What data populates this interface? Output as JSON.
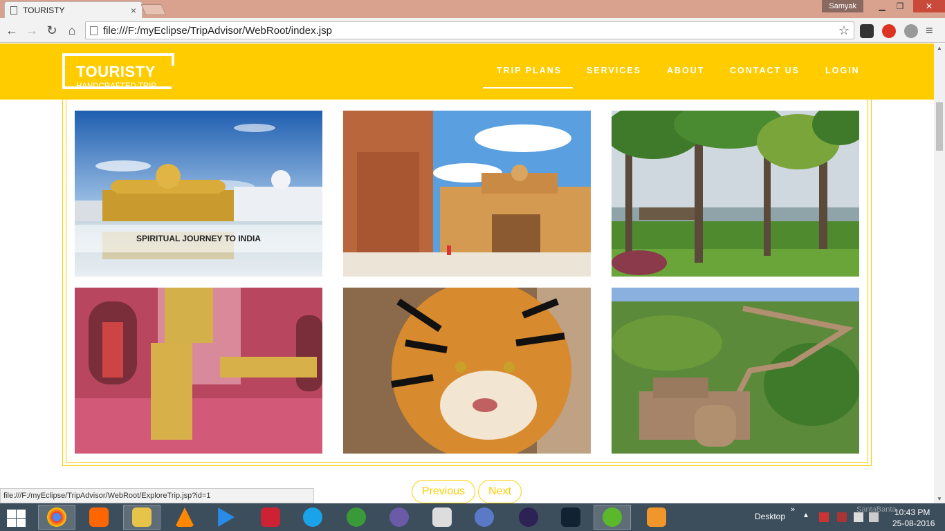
{
  "browser": {
    "tab_title": "TOURISTY",
    "tab_close": "×",
    "user_name": "Samyak",
    "url": "file:///F:/myEclipse/TripAdvisor/WebRoot/index.jsp",
    "status_url": "file:///F:/myEclipse/TripAdvisor/WebRoot/ExploreTrip.jsp?id=1",
    "icons": {
      "back": "arrow-left-icon",
      "forward": "arrow-right-icon",
      "reload": "reload-icon",
      "home": "home-icon",
      "bookmark": "star-icon",
      "menu": "hamburger-menu-icon"
    }
  },
  "site": {
    "logo_title": "TOURISTY",
    "logo_subtitle": "HANDCRAFTED TRIP",
    "nav": [
      {
        "label": "TRIP PLANS",
        "active": true
      },
      {
        "label": "SERVICES"
      },
      {
        "label": "ABOUT"
      },
      {
        "label": "CONTACT US"
      },
      {
        "label": "LOGIN"
      }
    ],
    "gallery": {
      "tiles": [
        {
          "id": "golden-temple",
          "caption": "SPIRITUAL JOURNEY TO INDIA"
        },
        {
          "id": "amber-fort"
        },
        {
          "id": "kerala-palms"
        },
        {
          "id": "buddha-statue"
        },
        {
          "id": "tiger"
        },
        {
          "id": "fort-ruins"
        }
      ]
    },
    "pager": {
      "previous": "Previous",
      "next": "Next"
    },
    "colors": {
      "brand": "#ffcc00",
      "text_on_brand": "#ffffff"
    }
  },
  "taskbar": {
    "desktop_label": "Desktop",
    "watermark": "SantaBanta",
    "time": "10:43 PM",
    "date": "25-08-2016",
    "apps": [
      "chrome",
      "uc-browser",
      "file-explorer",
      "vlc",
      "media-player",
      "screen-recorder",
      "skype",
      "globe-app",
      "tor-browser",
      "notepad",
      "dolphin-app",
      "eclipse",
      "me-app",
      "dreamweaver",
      "server-app"
    ]
  }
}
